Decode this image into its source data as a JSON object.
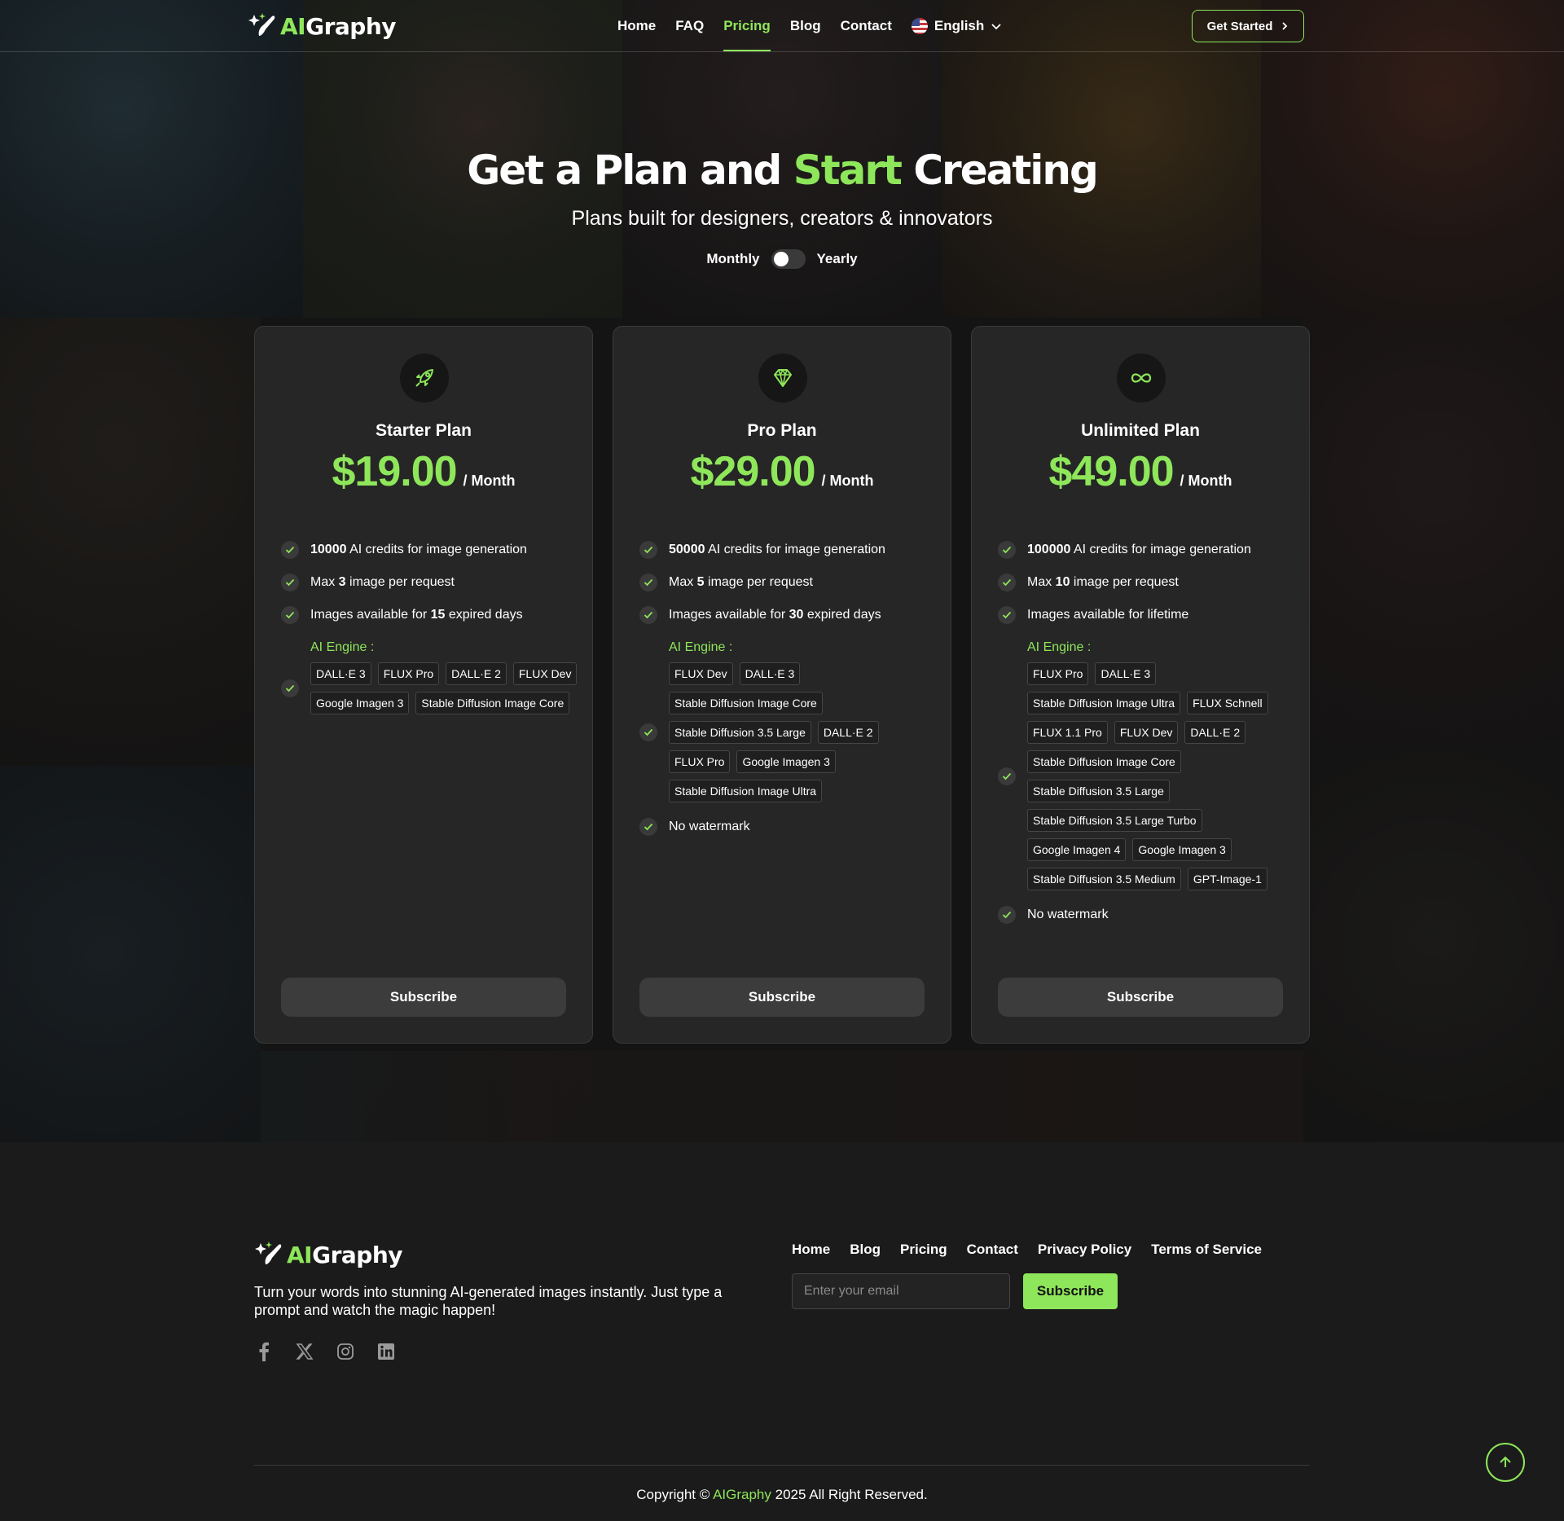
{
  "brand": {
    "name_ai": "AI",
    "name_rest": "Graphy"
  },
  "header": {
    "nav": [
      "Home",
      "FAQ",
      "Pricing",
      "Blog",
      "Contact"
    ],
    "active": "Pricing",
    "language": "English",
    "cta": "Get Started"
  },
  "hero": {
    "title_part1": "Get a Plan and",
    "title_accent": "Start",
    "title_part2": "Creating",
    "subtitle": "Plans built for designers, creators & innovators",
    "toggle_monthly": "Monthly",
    "toggle_yearly": "Yearly",
    "billing": "monthly"
  },
  "plans": [
    {
      "name": "Starter Plan",
      "icon": "rocket-icon",
      "price": "$19.00",
      "period": "/ Month",
      "features": [
        {
          "pre": "",
          "bold": "10000",
          "post": " AI credits for image generation"
        },
        {
          "pre": "Max ",
          "bold": "3",
          "post": " image per request"
        },
        {
          "pre": "Images available for ",
          "bold": "15",
          "post": " expired days"
        }
      ],
      "engine_label": "AI Engine :",
      "engines": [
        "DALL·E 3",
        "FLUX Pro",
        "DALL·E 2",
        "FLUX Dev",
        "Google Imagen 3",
        "Stable Diffusion Image Core"
      ],
      "extra": [],
      "button": "Subscribe"
    },
    {
      "name": "Pro Plan",
      "icon": "diamond-icon",
      "price": "$29.00",
      "period": "/ Month",
      "features": [
        {
          "pre": "",
          "bold": "50000",
          "post": " AI credits for image generation"
        },
        {
          "pre": "Max ",
          "bold": "5",
          "post": " image per request"
        },
        {
          "pre": "Images available for ",
          "bold": "30",
          "post": " expired days"
        }
      ],
      "engine_label": "AI Engine :",
      "engines": [
        "FLUX Dev",
        "DALL·E 3",
        "Stable Diffusion Image Core",
        "Stable Diffusion 3.5 Large",
        "DALL·E 2",
        "FLUX Pro",
        "Google Imagen 3",
        "Stable Diffusion Image Ultra"
      ],
      "extra": [
        "No watermark"
      ],
      "button": "Subscribe"
    },
    {
      "name": "Unlimited Plan",
      "icon": "infinity-icon",
      "price": "$49.00",
      "period": "/ Month",
      "features": [
        {
          "pre": "",
          "bold": "100000",
          "post": " AI credits for image generation"
        },
        {
          "pre": "Max ",
          "bold": "10",
          "post": " image per request"
        },
        {
          "pre": "Images available for lifetime",
          "bold": "",
          "post": ""
        }
      ],
      "engine_label": "AI Engine :",
      "engines": [
        "FLUX Pro",
        "DALL·E 3",
        "Stable Diffusion Image Ultra",
        "FLUX Schnell",
        "FLUX 1.1 Pro",
        "FLUX Dev",
        "DALL·E 2",
        "Stable Diffusion Image Core",
        "Stable Diffusion 3.5 Large",
        "Stable Diffusion 3.5 Large Turbo",
        "Google Imagen 4",
        "Google Imagen 3",
        "Stable Diffusion 3.5 Medium",
        "GPT-Image-1"
      ],
      "extra": [
        "No watermark"
      ],
      "button": "Subscribe"
    }
  ],
  "footer": {
    "tagline": "Turn your words into stunning AI-generated images instantly. Just type a prompt and watch the magic happen!",
    "socials": [
      "facebook-icon",
      "x-icon",
      "instagram-icon",
      "linkedin-icon"
    ],
    "nav": [
      "Home",
      "Blog",
      "Pricing",
      "Contact",
      "Privacy Policy",
      "Terms of Service"
    ],
    "email_placeholder": "Enter your email",
    "subscribe": "Subscribe",
    "copyright_pre": "Copyright ©",
    "copyright_brand": "AIGraphy",
    "copyright_post": "2025 All Right Reserved."
  },
  "colors": {
    "accent": "#8ee65a",
    "background": "#1b1b1b",
    "card": "#262626"
  }
}
